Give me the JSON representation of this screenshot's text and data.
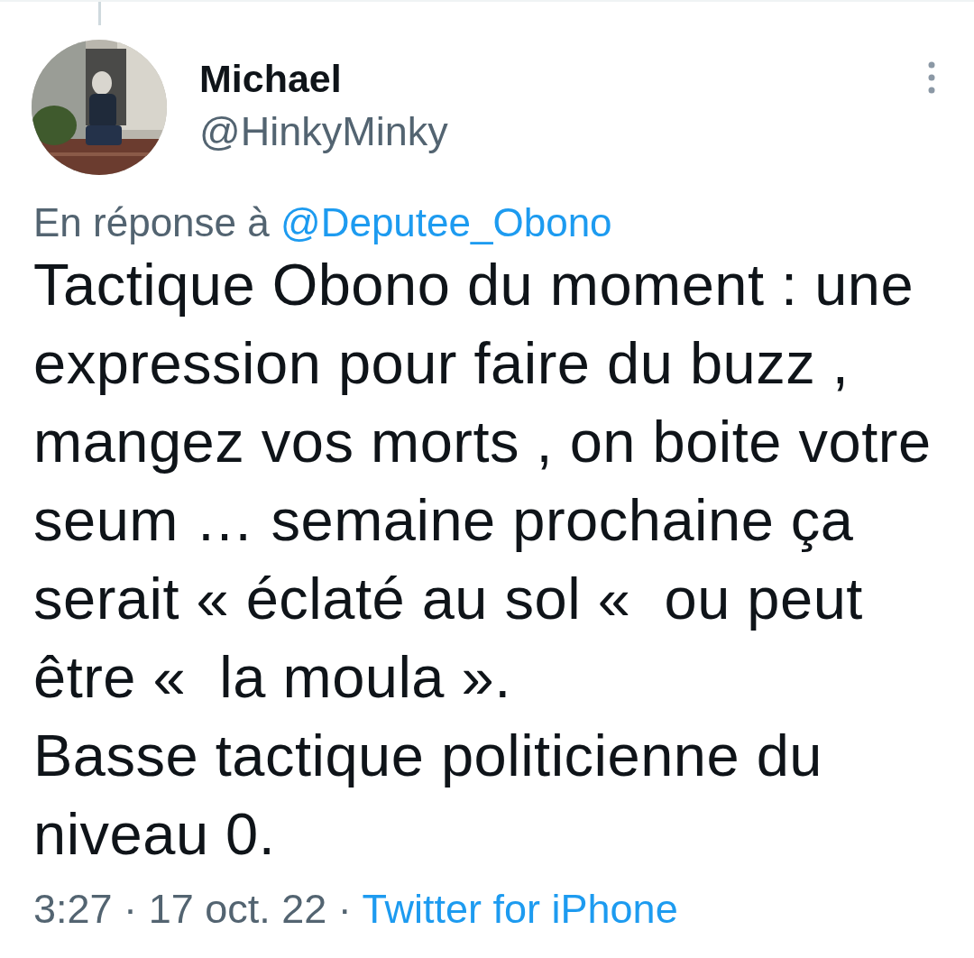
{
  "author": {
    "name": "Michael",
    "handle": "@HinkyMinky"
  },
  "reply_to": {
    "label": "En réponse à",
    "mention": "@Deputee_Obono"
  },
  "body": [
    "Tactique Obono du moment : une expression pour faire du buzz , mangez vos morts , on boite votre seum … semaine prochaine ça serait « éclaté au sol «  ou peut être «  la moula ».",
    "Basse tactique politicienne du niveau 0."
  ],
  "meta": {
    "time": "3:27",
    "separator_1": "·",
    "date": "17 oct. 22",
    "separator_2": "·",
    "source": "Twitter for iPhone"
  }
}
